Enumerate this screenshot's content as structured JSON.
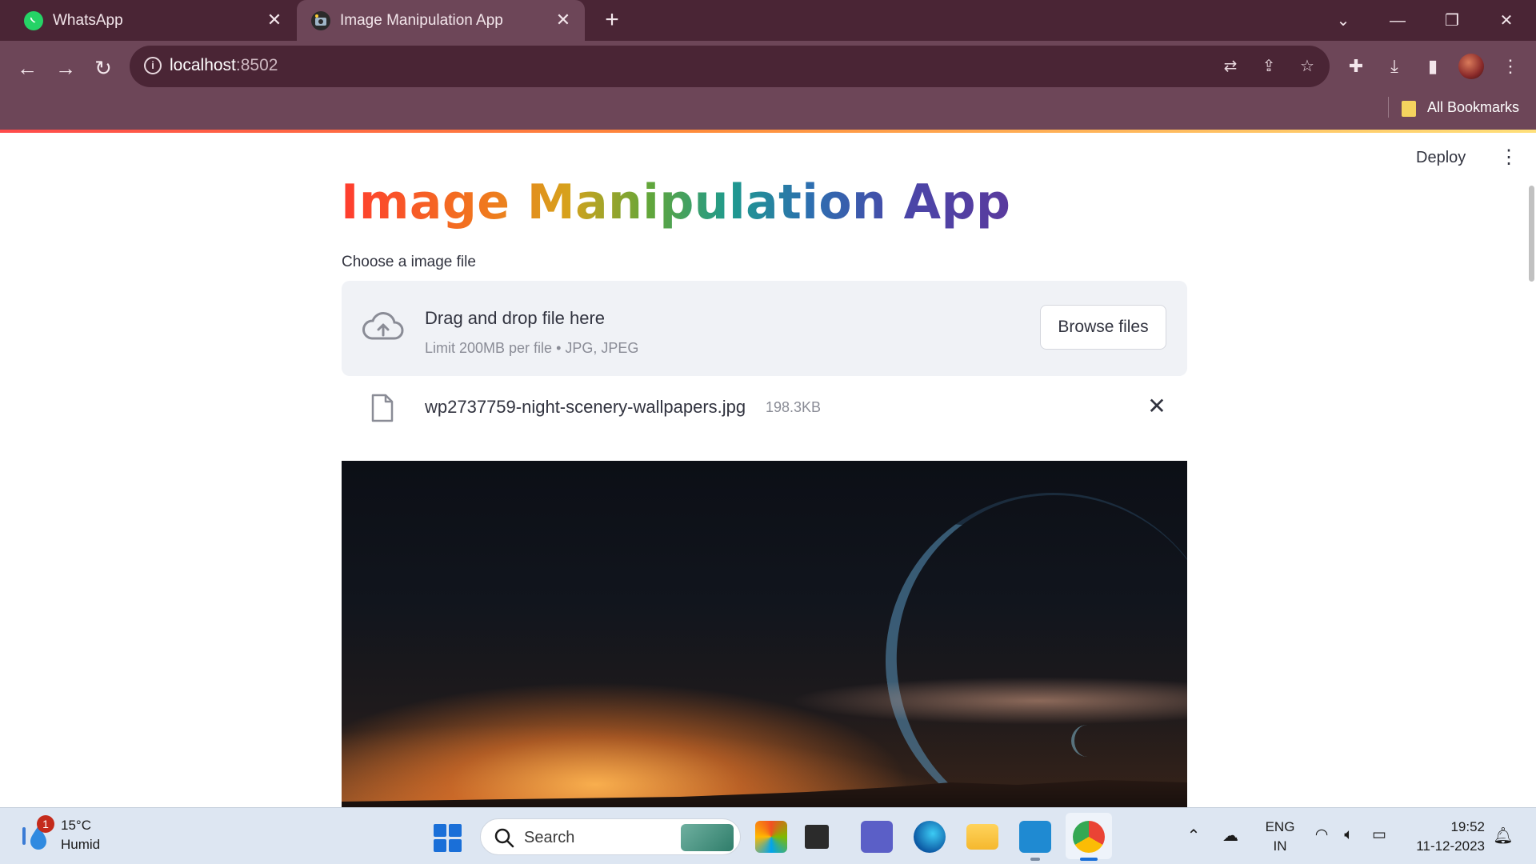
{
  "browser": {
    "tabs": [
      {
        "title": "WhatsApp",
        "active": false
      },
      {
        "title": "Image Manipulation App",
        "active": true
      }
    ],
    "address_host": "localhost",
    "address_port": ":8502",
    "bookmarks_label": "All Bookmarks"
  },
  "app": {
    "deploy_label": "Deploy",
    "title_words": [
      "Image",
      "Manipulation",
      "App"
    ],
    "uploader_label": "Choose a image file",
    "dropzone_title": "Drag and drop file here",
    "dropzone_limit": "Limit 200MB per file • JPG, JPEG",
    "browse_label": "Browse files",
    "uploaded_file": {
      "name": "wp2737759-night-scenery-wallpapers.jpg",
      "size": "198.3KB"
    }
  },
  "taskbar": {
    "weather_temp": "15°C",
    "weather_condition": "Humid",
    "weather_badge": "1",
    "search_label": "Search",
    "language_line1": "ENG",
    "language_line2": "IN",
    "time": "19:52",
    "date": "11-12-2023"
  },
  "colors": {
    "titlebar": "#4a2535",
    "toolbar": "#6d4658",
    "dropzone_bg": "#f0f2f6",
    "text": "#31333f",
    "taskbar": "#dde6f2"
  }
}
